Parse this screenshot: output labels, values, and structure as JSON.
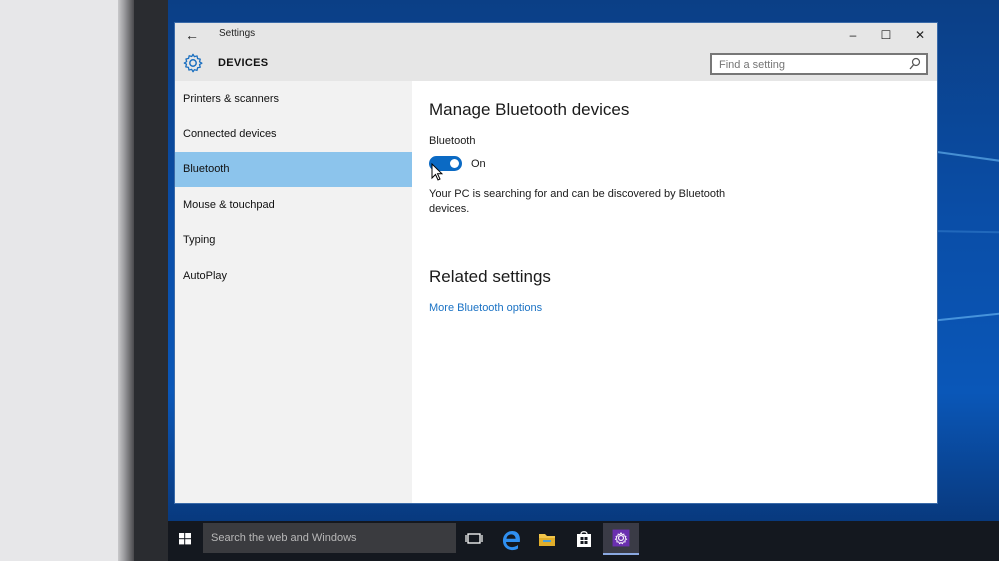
{
  "window": {
    "title": "Settings",
    "section": "DEVICES",
    "search_placeholder": "Find a setting"
  },
  "sidebar": {
    "items": [
      {
        "label": "Printers & scanners",
        "active": false
      },
      {
        "label": "Connected devices",
        "active": false
      },
      {
        "label": "Bluetooth",
        "active": true
      },
      {
        "label": "Mouse & touchpad",
        "active": false
      },
      {
        "label": "Typing",
        "active": false
      },
      {
        "label": "AutoPlay",
        "active": false
      }
    ]
  },
  "main": {
    "heading": "Manage Bluetooth devices",
    "bluetooth_label": "Bluetooth",
    "toggle_state": "On",
    "description": "Your PC is searching for and can be discovered by Bluetooth devices.",
    "related_heading": "Related settings",
    "related_link": "More Bluetooth options"
  },
  "taskbar": {
    "search_placeholder": "Search the web and Windows",
    "icons": [
      "task-view-icon",
      "edge-icon",
      "file-explorer-icon",
      "store-icon",
      "settings-icon"
    ]
  },
  "colors": {
    "accent": "#0b6ac4",
    "nav_active": "#8cc4ec",
    "link": "#1a72c4"
  }
}
